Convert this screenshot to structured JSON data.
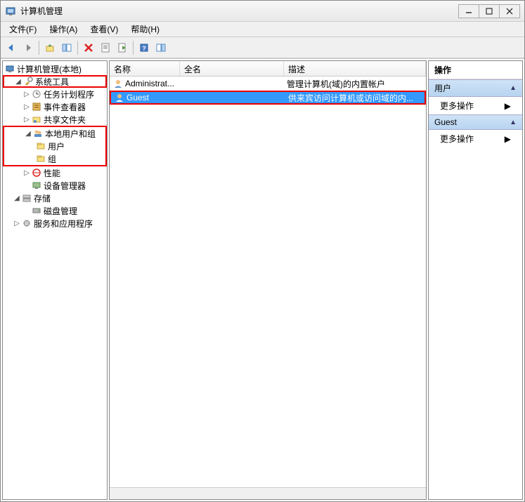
{
  "window": {
    "title": "计算机管理"
  },
  "menus": {
    "file": "文件(F)",
    "action": "操作(A)",
    "view": "查看(V)",
    "help": "帮助(H)"
  },
  "tree": {
    "root": "计算机管理(本地)",
    "system_tools": "系统工具",
    "task_scheduler": "任务计划程序",
    "event_viewer": "事件查看器",
    "shared_folders": "共享文件夹",
    "local_users_groups": "本地用户和组",
    "users": "用户",
    "groups": "组",
    "performance": "性能",
    "device_manager": "设备管理器",
    "storage": "存储",
    "disk_management": "磁盘管理",
    "services_apps": "服务和应用程序"
  },
  "list": {
    "header": {
      "name": "名称",
      "fullname": "全名",
      "description": "描述"
    },
    "rows": [
      {
        "name": "Administrat...",
        "fullname": "",
        "description": "管理计算机(域)的内置帐户",
        "selected": false
      },
      {
        "name": "Guest",
        "fullname": "",
        "description": "供来宾访问计算机或访问域的内...",
        "selected": true
      }
    ]
  },
  "actions": {
    "title": "操作",
    "section_users": "用户",
    "more_actions": "更多操作",
    "section_guest": "Guest"
  }
}
